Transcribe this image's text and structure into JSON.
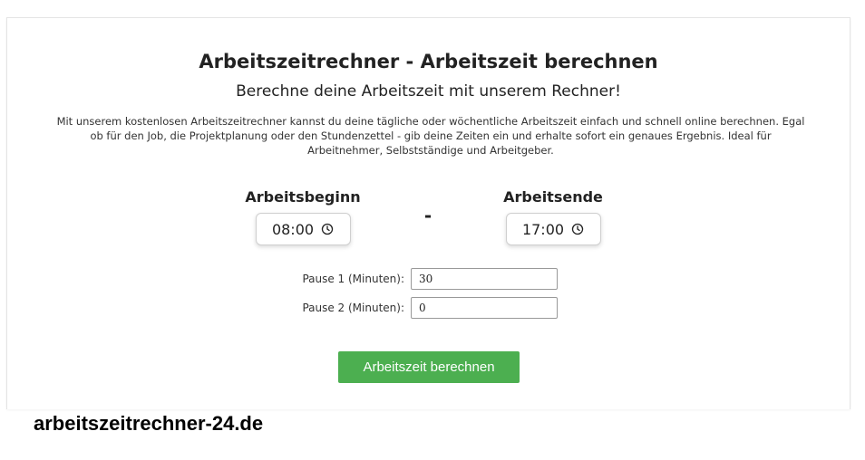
{
  "calculator": {
    "title": "Arbeitszeitrechner - Arbeitszeit berechnen",
    "subtitle": "Berechne deine Arbeitszeit mit unserem Rechner!",
    "description": "Mit unserem kostenlosen Arbeitszeitrechner kannst du deine tägliche oder wöchentliche Arbeitszeit einfach und schnell online berechnen. Egal ob für den Job, die Projektplanung oder den Stundenzettel - gib deine Zeiten ein und erhalte sofort ein genaues Ergebnis. Ideal für Arbeitnehmer, Selbstständige und Arbeitgeber.",
    "start": {
      "label": "Arbeitsbeginn",
      "value": "08:00",
      "icon": "clock-icon"
    },
    "separator": "-",
    "end": {
      "label": "Arbeitsende",
      "value": "17:00",
      "icon": "clock-icon"
    },
    "pauses": [
      {
        "label": "Pause 1 (Minuten):",
        "value": "30"
      },
      {
        "label": "Pause 2 (Minuten):",
        "value": "0"
      }
    ],
    "button_label": "Arbeitszeit berechnen",
    "accent_color": "#4caf50"
  },
  "footer": {
    "domain": "arbeitszeitrechner-24.de"
  }
}
